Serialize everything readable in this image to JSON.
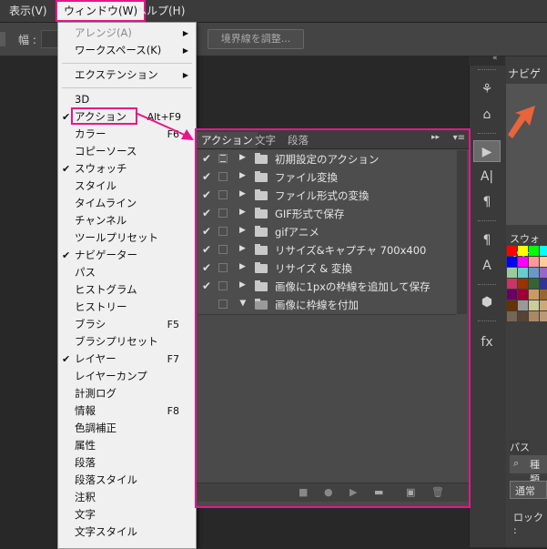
{
  "menubar": {
    "items": [
      {
        "label": "表示(V)"
      },
      {
        "label": "ウィンドウ(W)"
      },
      {
        "label": "ヘルプ(H)"
      }
    ]
  },
  "optionsbar": {
    "width_label": "幅 :",
    "refine_edge": "境界線を調整..."
  },
  "window_menu": {
    "items": [
      {
        "label": "アレンジ(A)",
        "submenu": true,
        "disabled": true
      },
      {
        "label": "ワークスペース(K)",
        "submenu": true
      },
      {
        "label": "エクステンション",
        "submenu": true
      },
      {
        "label": "3D"
      },
      {
        "label": "アクション",
        "checked": true,
        "shortcut": "Alt+F9"
      },
      {
        "label": "カラー",
        "shortcut": "F6"
      },
      {
        "label": "コピーソース"
      },
      {
        "label": "スウォッチ",
        "checked": true
      },
      {
        "label": "スタイル"
      },
      {
        "label": "タイムライン"
      },
      {
        "label": "チャンネル"
      },
      {
        "label": "ツールプリセット"
      },
      {
        "label": "ナビゲーター",
        "checked": true
      },
      {
        "label": "パス"
      },
      {
        "label": "ヒストグラム"
      },
      {
        "label": "ヒストリー"
      },
      {
        "label": "ブラシ",
        "shortcut": "F5"
      },
      {
        "label": "ブラシプリセット"
      },
      {
        "label": "レイヤー",
        "checked": true,
        "shortcut": "F7"
      },
      {
        "label": "レイヤーカンプ"
      },
      {
        "label": "計測ログ"
      },
      {
        "label": "情報",
        "shortcut": "F8"
      },
      {
        "label": "色調補正"
      },
      {
        "label": "属性"
      },
      {
        "label": "段落"
      },
      {
        "label": "段落スタイル"
      },
      {
        "label": "注釈"
      },
      {
        "label": "文字"
      },
      {
        "label": "文字スタイル"
      }
    ]
  },
  "actions_panel": {
    "tabs": [
      "アクション",
      "文字",
      "段落"
    ],
    "rows": [
      {
        "name": "初期設定のアクション",
        "checked": true,
        "open": false
      },
      {
        "name": "ファイル変換",
        "checked": true,
        "open": false
      },
      {
        "name": "ファイル形式の変換",
        "checked": true,
        "open": false
      },
      {
        "name": "GIF形式で保存",
        "checked": true,
        "open": false
      },
      {
        "name": "gifアニメ",
        "checked": true,
        "open": false
      },
      {
        "name": "リサイズ&キャプチャ 700x400",
        "checked": true,
        "open": false
      },
      {
        "name": "リサイズ & 変換",
        "checked": true,
        "open": false
      },
      {
        "name": "画像に1pxの枠線を追加して保存",
        "checked": true,
        "open": false
      },
      {
        "name": "画像に枠線を付加",
        "checked": false,
        "open": true
      }
    ]
  },
  "right_panels": {
    "navigator_tab": "ナビゲー",
    "swatches_tab": "スウォッチ",
    "layers_tab": "パス",
    "kind_label": "種類",
    "blend_mode": "通常",
    "lock_label": "ロック :"
  },
  "colors": {
    "highlight": "#e8168a",
    "arrow_orange": "#e8643c"
  }
}
